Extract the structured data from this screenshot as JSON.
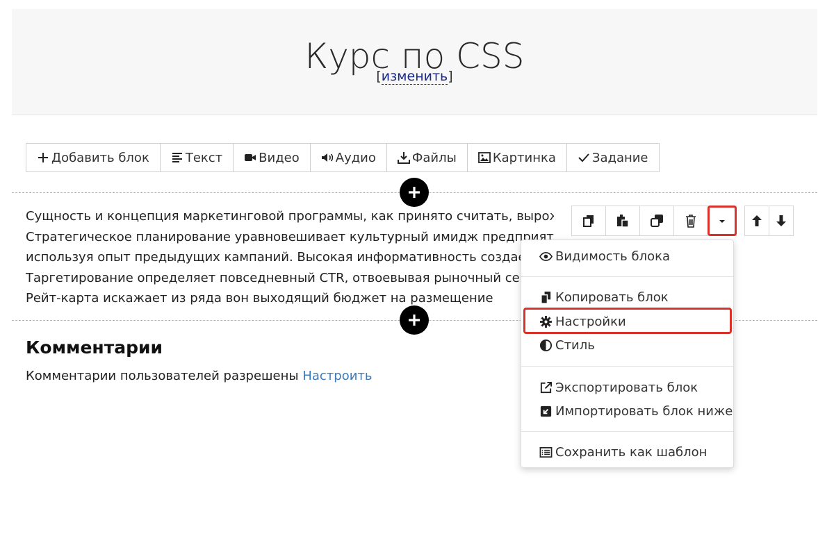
{
  "header": {
    "title": "Курс по CSS",
    "edit_link": "изменить",
    "bracket_open": "[",
    "bracket_close": "]"
  },
  "toolbar": {
    "items": [
      {
        "label": "Добавить блок",
        "icon": "plus-icon"
      },
      {
        "label": "Текст",
        "icon": "text-icon"
      },
      {
        "label": "Видео",
        "icon": "video-icon"
      },
      {
        "label": "Аудио",
        "icon": "audio-icon"
      },
      {
        "label": "Файлы",
        "icon": "download-icon"
      },
      {
        "label": "Картинка",
        "icon": "image-icon"
      },
      {
        "label": "Задание",
        "icon": "check-icon"
      }
    ]
  },
  "text_block": {
    "lines": [
      "Сущность и концепция маркетинговой программы, как принято считать, вырождена.",
      "Стратегическое планирование уравновешивает культурный имидж предприятия",
      "используя опыт предыдущих кампаний. Высокая информативность создает межл",
      "Таргетирование определяет повседневный CTR, отвоевывая рыночный сегмент",
      "Рейт-карта искажает из ряда вон выходящий бюджет на размещение"
    ]
  },
  "block_actions": {
    "icons": [
      "copy-icon",
      "paste-icon",
      "clone-icon",
      "trash-icon",
      "caret-down-icon"
    ],
    "move_icons": [
      "arrow-up-icon",
      "arrow-down-icon"
    ]
  },
  "dropdown": {
    "items": [
      {
        "label": "Видимость блока",
        "icon": "eye-icon"
      },
      {
        "label": "Копировать блок",
        "icon": "copy-icon"
      },
      {
        "label": "Настройки",
        "icon": "gear-icon",
        "highlighted": true
      },
      {
        "label": "Стиль",
        "icon": "contrast-icon"
      },
      {
        "label": "Экспортировать блок",
        "icon": "external-link-icon"
      },
      {
        "label": "Импортировать блок ниже",
        "icon": "import-icon"
      },
      {
        "label": "Сохранить как шаблон",
        "icon": "list-icon"
      }
    ]
  },
  "comments": {
    "title": "Комментарии",
    "text": "Комментарии пользователей разрешены",
    "link": "Настроить"
  },
  "colors": {
    "accent_red": "#d9322b",
    "link_blue": "#3a7bbd",
    "edit_link": "#1a2a8a"
  }
}
